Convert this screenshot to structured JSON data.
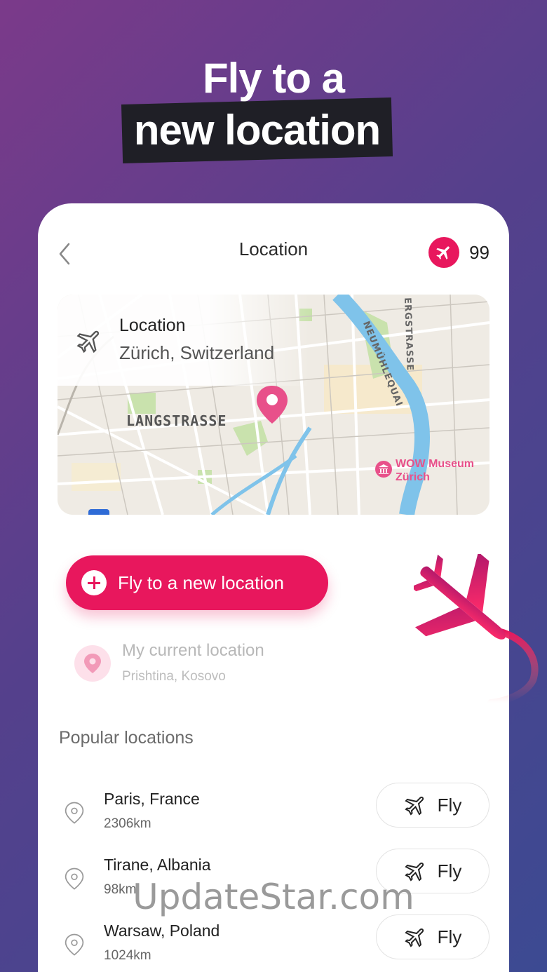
{
  "headline": {
    "line1": "Fly to a",
    "line2": "new location"
  },
  "header": {
    "title": "Location",
    "credits": "99"
  },
  "map": {
    "label": "Location",
    "value": "Zürich, Switzerland",
    "street_main": "LANGSTRASSE",
    "street_river": "NEUMÜHLEQUAI",
    "street_top": "ERGSTRASSE",
    "poi_line1": "WOW Museum",
    "poi_line2": "Zürich"
  },
  "actions": {
    "fly_new": "Fly to a new location"
  },
  "current_location": {
    "label": "My current location",
    "value": "Prishtina, Kosovo"
  },
  "popular": {
    "title": "Popular locations",
    "fly_label": "Fly",
    "items": [
      {
        "name": "Paris, France",
        "distance": "2306km"
      },
      {
        "name": "Tirane, Albania",
        "distance": "98km"
      },
      {
        "name": "Warsaw, Poland",
        "distance": "1024km"
      }
    ]
  },
  "watermark": "UpdateStar.com",
  "colors": {
    "accent": "#e8175d",
    "accent_light": "#fde0ea",
    "background_start": "#7b3a8a",
    "background_end": "#3c4a92"
  },
  "icons": [
    "chevron-left-icon",
    "airplane-icon",
    "map-pin-icon",
    "plus-icon",
    "museum-icon"
  ]
}
